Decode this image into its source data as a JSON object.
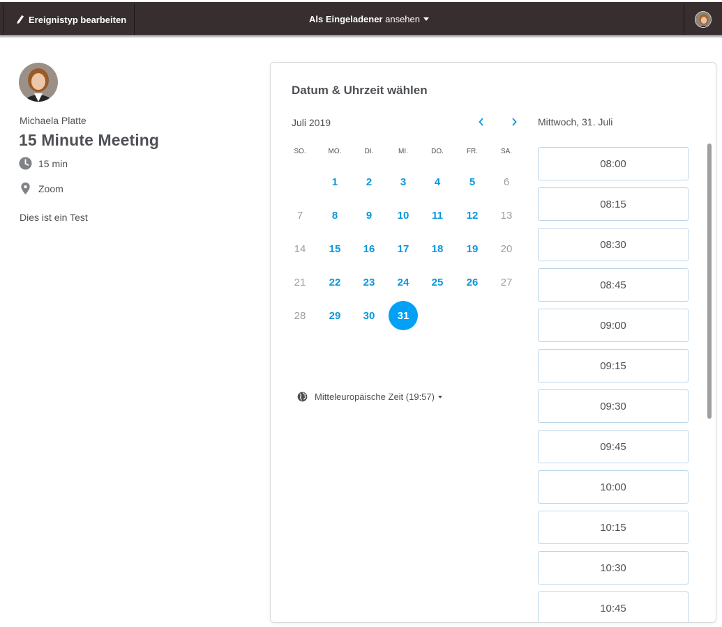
{
  "topbar": {
    "edit_label": "Ereignistyp bearbeiten",
    "view_as_bold": "Als Eingeladener",
    "view_as_rest": "ansehen"
  },
  "host": {
    "name": "Michaela Platte",
    "event_title": "15 Minute Meeting",
    "duration": "15 min",
    "location": "Zoom",
    "description": "Dies ist ein Test"
  },
  "calendar": {
    "title": "Datum & Uhrzeit wählen",
    "month": "Juli 2019",
    "weekdays": [
      "SO.",
      "MO.",
      "DI.",
      "MI.",
      "DO.",
      "FR.",
      "SA."
    ],
    "weeks": [
      [
        null,
        {
          "d": "1",
          "s": "avail"
        },
        {
          "d": "2",
          "s": "avail"
        },
        {
          "d": "3",
          "s": "avail"
        },
        {
          "d": "4",
          "s": "avail"
        },
        {
          "d": "5",
          "s": "avail"
        },
        {
          "d": "6",
          "s": "unavail"
        }
      ],
      [
        {
          "d": "7",
          "s": "unavail"
        },
        {
          "d": "8",
          "s": "avail"
        },
        {
          "d": "9",
          "s": "avail"
        },
        {
          "d": "10",
          "s": "avail"
        },
        {
          "d": "11",
          "s": "avail"
        },
        {
          "d": "12",
          "s": "avail"
        },
        {
          "d": "13",
          "s": "unavail"
        }
      ],
      [
        {
          "d": "14",
          "s": "unavail"
        },
        {
          "d": "15",
          "s": "avail"
        },
        {
          "d": "16",
          "s": "avail"
        },
        {
          "d": "17",
          "s": "avail"
        },
        {
          "d": "18",
          "s": "avail"
        },
        {
          "d": "19",
          "s": "avail"
        },
        {
          "d": "20",
          "s": "unavail"
        }
      ],
      [
        {
          "d": "21",
          "s": "unavail"
        },
        {
          "d": "22",
          "s": "avail"
        },
        {
          "d": "23",
          "s": "avail"
        },
        {
          "d": "24",
          "s": "avail"
        },
        {
          "d": "25",
          "s": "avail"
        },
        {
          "d": "26",
          "s": "avail"
        },
        {
          "d": "27",
          "s": "unavail"
        }
      ],
      [
        {
          "d": "28",
          "s": "unavail"
        },
        {
          "d": "29",
          "s": "avail"
        },
        {
          "d": "30",
          "s": "avail"
        },
        {
          "d": "31",
          "s": "selected"
        },
        null,
        null,
        null
      ]
    ],
    "timezone": "Mitteleuropäische Zeit (19:57)"
  },
  "times": {
    "selected_date": "Mittwoch, 31. Juli",
    "slots": [
      "08:00",
      "08:15",
      "08:30",
      "08:45",
      "09:00",
      "09:15",
      "09:30",
      "09:45",
      "10:00",
      "10:15",
      "10:30",
      "10:45"
    ]
  },
  "colors": {
    "topbar": "#372f2f",
    "accent": "#0a97d9",
    "selected": "#03a0f6"
  }
}
